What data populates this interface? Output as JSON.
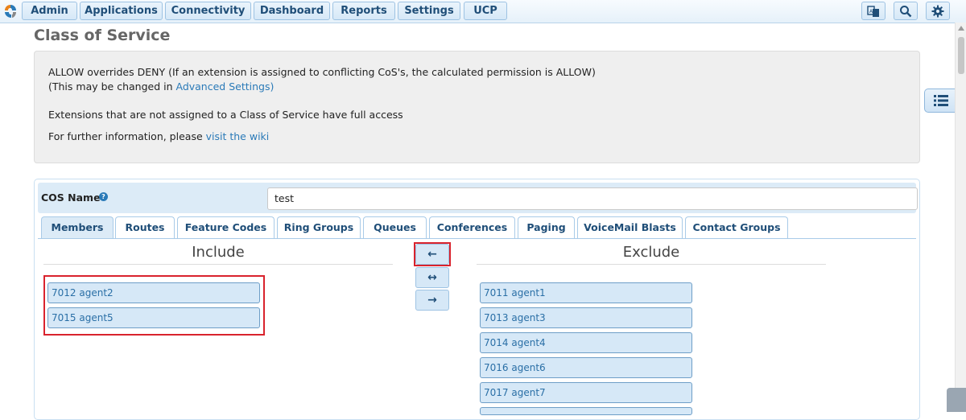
{
  "nav": {
    "items": [
      "Admin",
      "Applications",
      "Connectivity",
      "Dashboard",
      "Reports",
      "Settings",
      "UCP"
    ],
    "icons": [
      "language-icon",
      "search-icon",
      "gear-icon"
    ]
  },
  "page": {
    "title": "Class of Service"
  },
  "info": {
    "line1": "ALLOW overrides DENY (If an extension is assigned to conflicting CoS's, the calculated permission is ALLOW)",
    "line2_prefix": "(This may be changed in ",
    "line2_link": "Advanced Settings)",
    "line3": "Extensions that are not assigned to a Class of Service have full access",
    "line4_prefix": "For further information, please ",
    "line4_link": "visit the wiki"
  },
  "form": {
    "cos_label": "COS Name",
    "cos_value": "test",
    "tabs": [
      "Members",
      "Routes",
      "Feature Codes",
      "Ring Groups",
      "Queues",
      "Conferences",
      "Paging",
      "VoiceMail Blasts",
      "Contact Groups"
    ],
    "active_tab": "Members"
  },
  "include": {
    "heading": "Include",
    "items": [
      "7012  agent2",
      "7015  agent5"
    ]
  },
  "exclude": {
    "heading": "Exclude",
    "items": [
      "7011  agent1",
      "7013  agent3",
      "7014  agent4",
      "7016  agent6",
      "7017  agent7"
    ]
  },
  "transfer": {
    "move_left": "←",
    "swap": "↔",
    "move_right": "→"
  },
  "colors": {
    "accent": "#2a7ab8",
    "item_bg": "#d6e8f7",
    "highlight": "#d9232d"
  }
}
